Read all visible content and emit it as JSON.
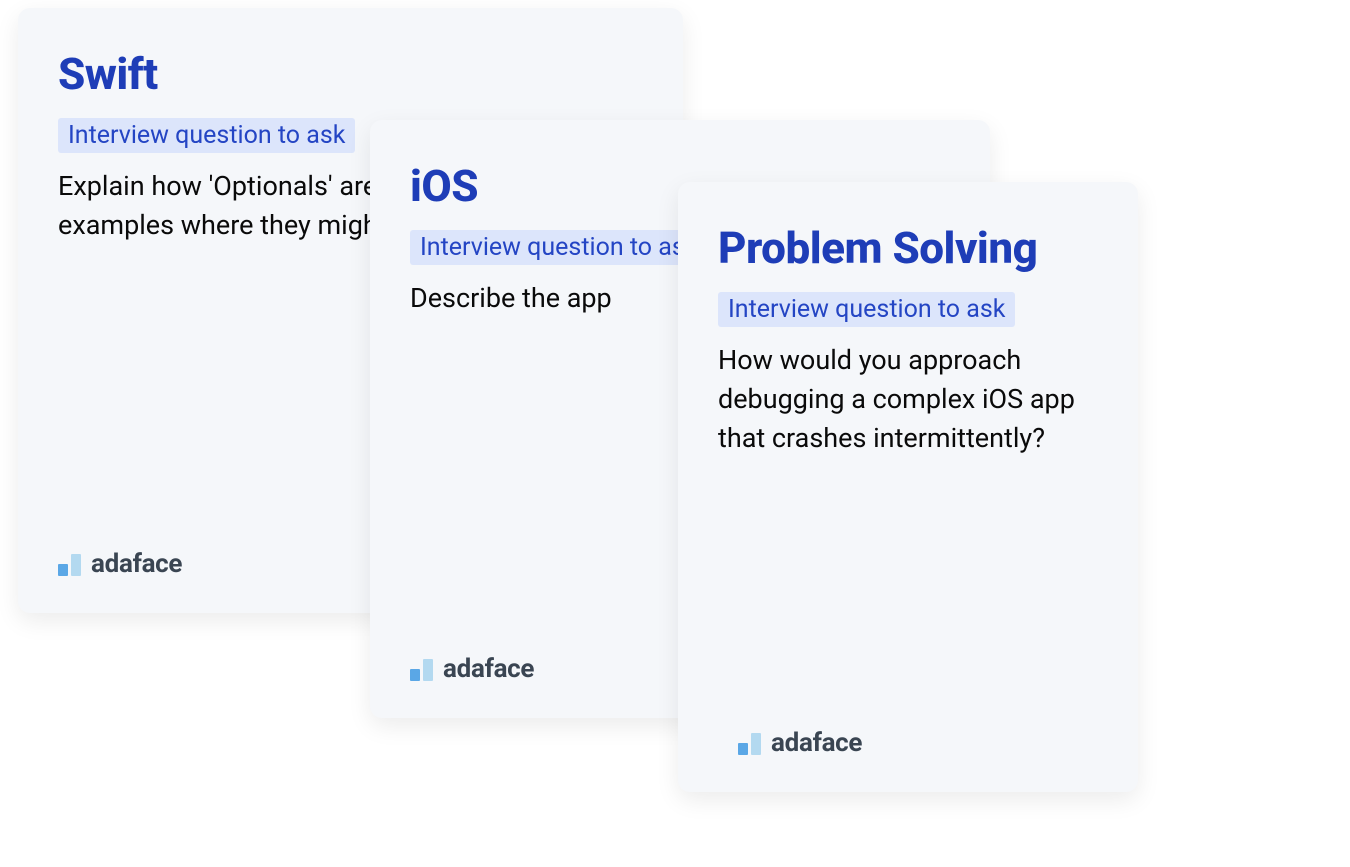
{
  "cards": [
    {
      "title": "Swift",
      "subtitle": "Interview question to ask",
      "body": "Explain how 'Optionals' are used and give examples where they might be applied."
    },
    {
      "title": "iOS",
      "subtitle": "Interview question to ask",
      "body": "Describe the app"
    },
    {
      "title": "Problem Solving",
      "subtitle": "Interview question to ask",
      "body": "How would you approach debugging a complex iOS app that crashes intermittently?"
    }
  ],
  "brand": "adaface"
}
